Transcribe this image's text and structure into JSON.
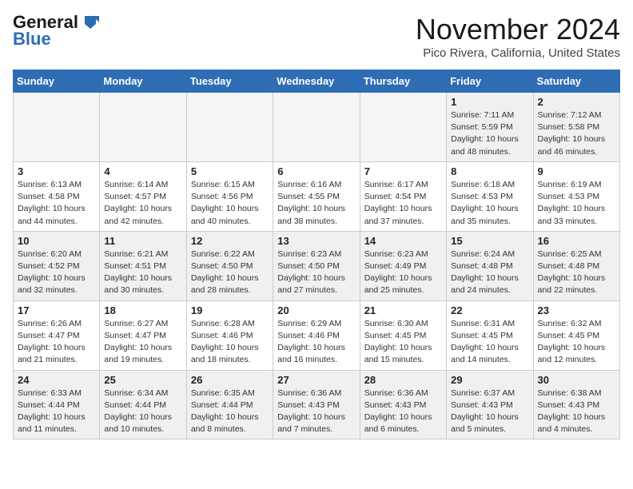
{
  "logo": {
    "line1": "General",
    "line2": "Blue"
  },
  "title": "November 2024",
  "location": "Pico Rivera, California, United States",
  "weekdays": [
    "Sunday",
    "Monday",
    "Tuesday",
    "Wednesday",
    "Thursday",
    "Friday",
    "Saturday"
  ],
  "weeks": [
    [
      {
        "day": "",
        "info": ""
      },
      {
        "day": "",
        "info": ""
      },
      {
        "day": "",
        "info": ""
      },
      {
        "day": "",
        "info": ""
      },
      {
        "day": "",
        "info": ""
      },
      {
        "day": "1",
        "info": "Sunrise: 7:11 AM\nSunset: 5:59 PM\nDaylight: 10 hours\nand 48 minutes."
      },
      {
        "day": "2",
        "info": "Sunrise: 7:12 AM\nSunset: 5:58 PM\nDaylight: 10 hours\nand 46 minutes."
      }
    ],
    [
      {
        "day": "3",
        "info": "Sunrise: 6:13 AM\nSunset: 4:58 PM\nDaylight: 10 hours\nand 44 minutes."
      },
      {
        "day": "4",
        "info": "Sunrise: 6:14 AM\nSunset: 4:57 PM\nDaylight: 10 hours\nand 42 minutes."
      },
      {
        "day": "5",
        "info": "Sunrise: 6:15 AM\nSunset: 4:56 PM\nDaylight: 10 hours\nand 40 minutes."
      },
      {
        "day": "6",
        "info": "Sunrise: 6:16 AM\nSunset: 4:55 PM\nDaylight: 10 hours\nand 38 minutes."
      },
      {
        "day": "7",
        "info": "Sunrise: 6:17 AM\nSunset: 4:54 PM\nDaylight: 10 hours\nand 37 minutes."
      },
      {
        "day": "8",
        "info": "Sunrise: 6:18 AM\nSunset: 4:53 PM\nDaylight: 10 hours\nand 35 minutes."
      },
      {
        "day": "9",
        "info": "Sunrise: 6:19 AM\nSunset: 4:53 PM\nDaylight: 10 hours\nand 33 minutes."
      }
    ],
    [
      {
        "day": "10",
        "info": "Sunrise: 6:20 AM\nSunset: 4:52 PM\nDaylight: 10 hours\nand 32 minutes."
      },
      {
        "day": "11",
        "info": "Sunrise: 6:21 AM\nSunset: 4:51 PM\nDaylight: 10 hours\nand 30 minutes."
      },
      {
        "day": "12",
        "info": "Sunrise: 6:22 AM\nSunset: 4:50 PM\nDaylight: 10 hours\nand 28 minutes."
      },
      {
        "day": "13",
        "info": "Sunrise: 6:23 AM\nSunset: 4:50 PM\nDaylight: 10 hours\nand 27 minutes."
      },
      {
        "day": "14",
        "info": "Sunrise: 6:23 AM\nSunset: 4:49 PM\nDaylight: 10 hours\nand 25 minutes."
      },
      {
        "day": "15",
        "info": "Sunrise: 6:24 AM\nSunset: 4:48 PM\nDaylight: 10 hours\nand 24 minutes."
      },
      {
        "day": "16",
        "info": "Sunrise: 6:25 AM\nSunset: 4:48 PM\nDaylight: 10 hours\nand 22 minutes."
      }
    ],
    [
      {
        "day": "17",
        "info": "Sunrise: 6:26 AM\nSunset: 4:47 PM\nDaylight: 10 hours\nand 21 minutes."
      },
      {
        "day": "18",
        "info": "Sunrise: 6:27 AM\nSunset: 4:47 PM\nDaylight: 10 hours\nand 19 minutes."
      },
      {
        "day": "19",
        "info": "Sunrise: 6:28 AM\nSunset: 4:46 PM\nDaylight: 10 hours\nand 18 minutes."
      },
      {
        "day": "20",
        "info": "Sunrise: 6:29 AM\nSunset: 4:46 PM\nDaylight: 10 hours\nand 16 minutes."
      },
      {
        "day": "21",
        "info": "Sunrise: 6:30 AM\nSunset: 4:45 PM\nDaylight: 10 hours\nand 15 minutes."
      },
      {
        "day": "22",
        "info": "Sunrise: 6:31 AM\nSunset: 4:45 PM\nDaylight: 10 hours\nand 14 minutes."
      },
      {
        "day": "23",
        "info": "Sunrise: 6:32 AM\nSunset: 4:45 PM\nDaylight: 10 hours\nand 12 minutes."
      }
    ],
    [
      {
        "day": "24",
        "info": "Sunrise: 6:33 AM\nSunset: 4:44 PM\nDaylight: 10 hours\nand 11 minutes."
      },
      {
        "day": "25",
        "info": "Sunrise: 6:34 AM\nSunset: 4:44 PM\nDaylight: 10 hours\nand 10 minutes."
      },
      {
        "day": "26",
        "info": "Sunrise: 6:35 AM\nSunset: 4:44 PM\nDaylight: 10 hours\nand 8 minutes."
      },
      {
        "day": "27",
        "info": "Sunrise: 6:36 AM\nSunset: 4:43 PM\nDaylight: 10 hours\nand 7 minutes."
      },
      {
        "day": "28",
        "info": "Sunrise: 6:36 AM\nSunset: 4:43 PM\nDaylight: 10 hours\nand 6 minutes."
      },
      {
        "day": "29",
        "info": "Sunrise: 6:37 AM\nSunset: 4:43 PM\nDaylight: 10 hours\nand 5 minutes."
      },
      {
        "day": "30",
        "info": "Sunrise: 6:38 AM\nSunset: 4:43 PM\nDaylight: 10 hours\nand 4 minutes."
      }
    ]
  ]
}
